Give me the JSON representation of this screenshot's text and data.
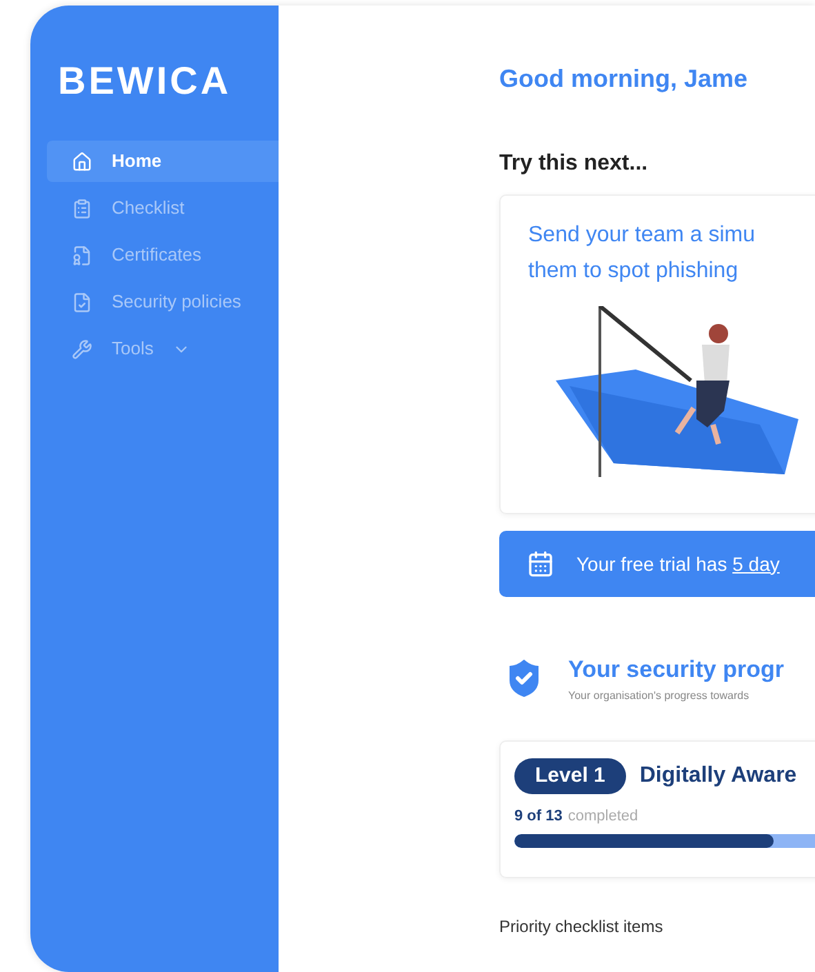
{
  "sidebar": {
    "logo": "BEWICA",
    "items": [
      {
        "label": "Home",
        "selected": true
      },
      {
        "label": "Checklist",
        "selected": false
      },
      {
        "label": "Certificates",
        "selected": false
      },
      {
        "label": "Security policies",
        "selected": false
      },
      {
        "label": "Tools",
        "selected": false,
        "expandable": true
      }
    ]
  },
  "greeting": "Good morning, Jame",
  "next": {
    "heading": "Try this next...",
    "text": "Send your team a simu them to spot phishing"
  },
  "trial": {
    "text": "Your free trial has",
    "link": "5 day"
  },
  "progress": {
    "title": "Your security progr",
    "subtitle": "Your organisation's progress towards",
    "badge": "Level 1",
    "level_name": "Digitally Aware",
    "count": "9 of 13",
    "count_label": "completed",
    "level": 0.69
  },
  "priority": "Priority checklist items"
}
